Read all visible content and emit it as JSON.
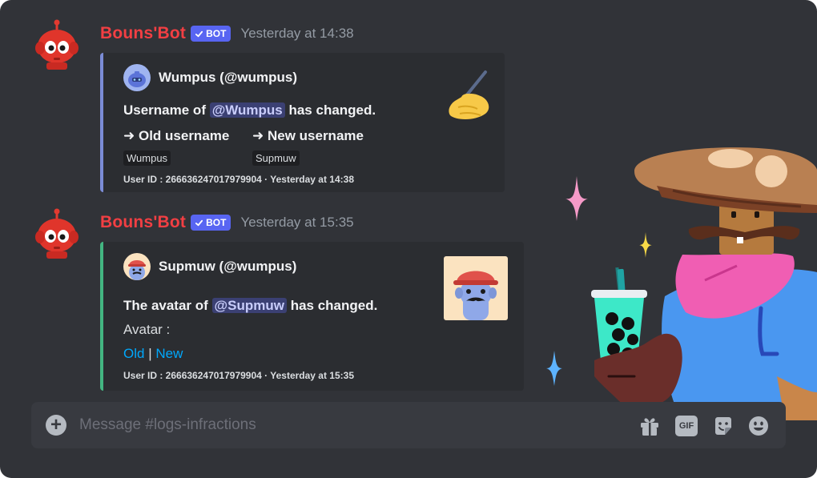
{
  "messages": [
    {
      "author": "Bouns'Bot",
      "bot_tag": "BOT",
      "timestamp": "Yesterday at 14:38",
      "embed": {
        "accent": "#7b8cd6",
        "author_name": "Wumpus (@wumpus)",
        "title_prefix": "Username of ",
        "title_mention": "@Wumpus",
        "title_suffix": " has changed.",
        "fields": [
          {
            "name": "➜ Old username",
            "value": "Wumpus"
          },
          {
            "name": "➜ New username",
            "value": "Supmuw"
          }
        ],
        "footer": "User ID : 266636247017979904 · Yesterday at 14:38"
      }
    },
    {
      "author": "Bouns'Bot",
      "bot_tag": "BOT",
      "timestamp": "Yesterday at 15:35",
      "embed": {
        "accent": "#43b581",
        "author_name": "Supmuw (@wumpus)",
        "title_prefix": "The avatar of ",
        "title_mention": "@Supmuw",
        "title_suffix": " has changed.",
        "description": "Avatar :",
        "link_old": "Old",
        "link_sep": " | ",
        "link_new": "New",
        "footer": "User ID : 266636247017979904 · Yesterday at 15:35"
      }
    }
  ],
  "composer": {
    "placeholder": "Message #logs-infractions",
    "gif_label": "GIF"
  },
  "colors": {
    "background": "#313338",
    "author": "#f23f43",
    "bot_tag": "#5865f2",
    "link": "#00a8fc",
    "composer": "#383a40"
  },
  "icons": [
    "bot-avatar-icon",
    "verified-check-icon",
    "wumpus-icon",
    "supmuw-icon",
    "writing-hand-icon",
    "add-attachment-icon",
    "gift-icon",
    "gif-icon",
    "sticker-icon",
    "emoji-icon",
    "sparkle-icon",
    "mushroom-character-illustration"
  ]
}
